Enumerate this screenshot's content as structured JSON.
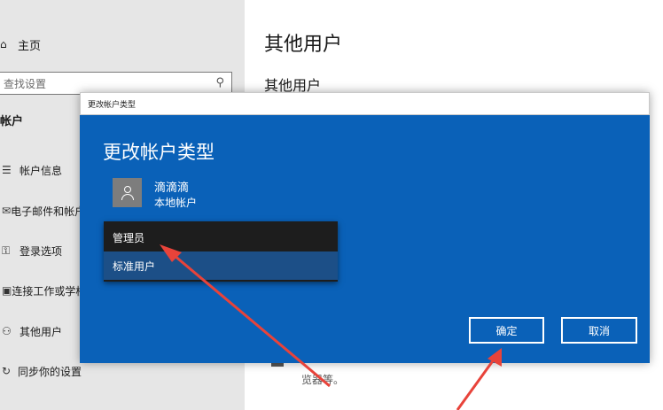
{
  "sidebar": {
    "home_label": "主页",
    "search_placeholder": "查找设置",
    "section_title": "帐户",
    "items": [
      {
        "label": "帐户信息"
      },
      {
        "label": "电子邮件和帐户"
      },
      {
        "label": "登录选项"
      },
      {
        "label": "连接工作或学校帐户"
      },
      {
        "label": "其他用户"
      },
      {
        "label": "同步你的设置"
      }
    ]
  },
  "main": {
    "title": "其他用户",
    "subtitle": "其他用户",
    "snippet_line1": "",
    "snippet_line2": "览器等。"
  },
  "dialog": {
    "window_title": "更改帐户类型",
    "heading": "更改帐户类型",
    "user_name": "滴滴滴",
    "user_type": "本地帐户",
    "dropdown_options": [
      {
        "label": "管理员"
      },
      {
        "label": "标准用户"
      }
    ],
    "ok_label": "确定",
    "cancel_label": "取消"
  },
  "colors": {
    "dialog_bg": "#0a61b8",
    "dropdown_bg": "#1d1d1d",
    "dropdown_highlight": "#1c4f87",
    "arrow": "#e8433a"
  },
  "icons": [
    "home-icon",
    "search-icon",
    "person-icon"
  ]
}
